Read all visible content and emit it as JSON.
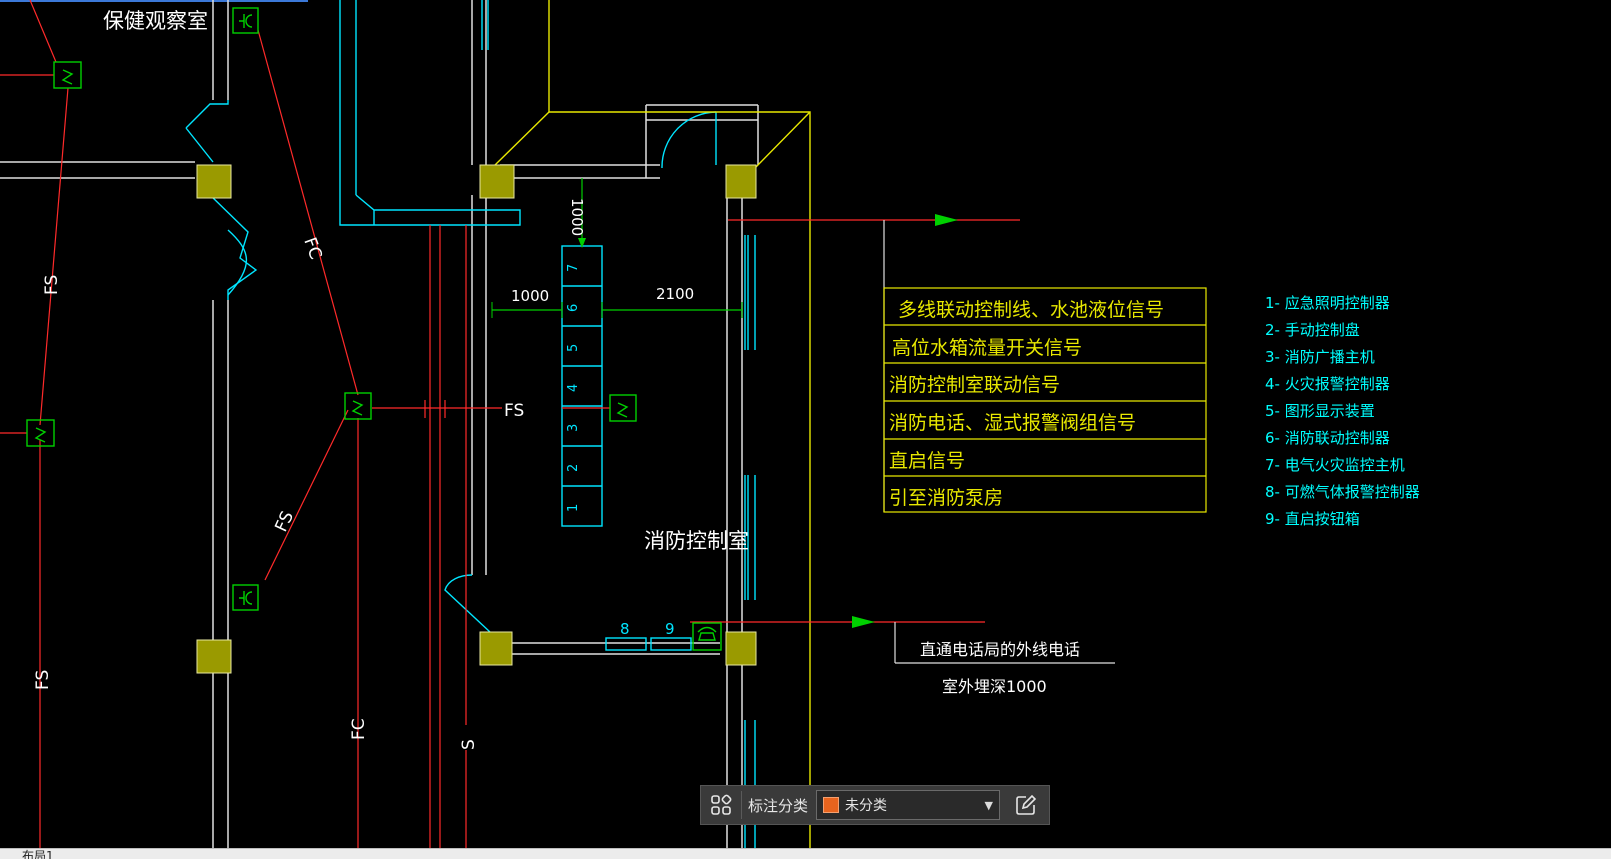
{
  "drawing": {
    "room_labels": {
      "health_room": "保健观察室",
      "fire_control_room": "消防控制室"
    },
    "line_labels": {
      "fs": "FS",
      "fc": "FC",
      "s": "S"
    },
    "dimensions": {
      "d1000_vertical": "1000",
      "d1000": "1000",
      "d2100": "2100"
    },
    "cabinet_numbers": [
      "1",
      "2",
      "3",
      "4",
      "5",
      "6",
      "7"
    ],
    "extra_devices": [
      "8",
      "9"
    ],
    "signal_table": [
      "多线联动控制线、水池液位信号",
      "高位水箱流量开关信号",
      "消防控制室联动信号",
      "消防电话、湿式报警阀组信号",
      "直启信号",
      "引至消防泵房"
    ],
    "phone_note": {
      "line1": "直通电话局的外线电话",
      "line2": "室外埋深1000"
    },
    "legend": [
      "1- 应急照明控制器",
      "2- 手动控制盘",
      "3- 消防广播主机",
      "4- 火灾报警控制器",
      "5- 图形显示装置",
      "6- 消防联动控制器",
      "7- 电气火灾监控主机",
      "8- 可燃气体报警控制器",
      "9- 直启按钮箱"
    ],
    "colors": {
      "wall": "#00e5ff",
      "line": "#ff2a2a",
      "device": "#00d000",
      "column": "#9a9a00",
      "table": "#e8e800",
      "legend": "#00ffff",
      "text": "#ffffff"
    }
  },
  "toolbar": {
    "grid_icon": "grid-icon",
    "label": "标注分类",
    "select_value": "未分类",
    "select_color": "#e8641e",
    "edit_icon": "edit-icon"
  },
  "tabs": {
    "layout_tab": "布局1"
  }
}
